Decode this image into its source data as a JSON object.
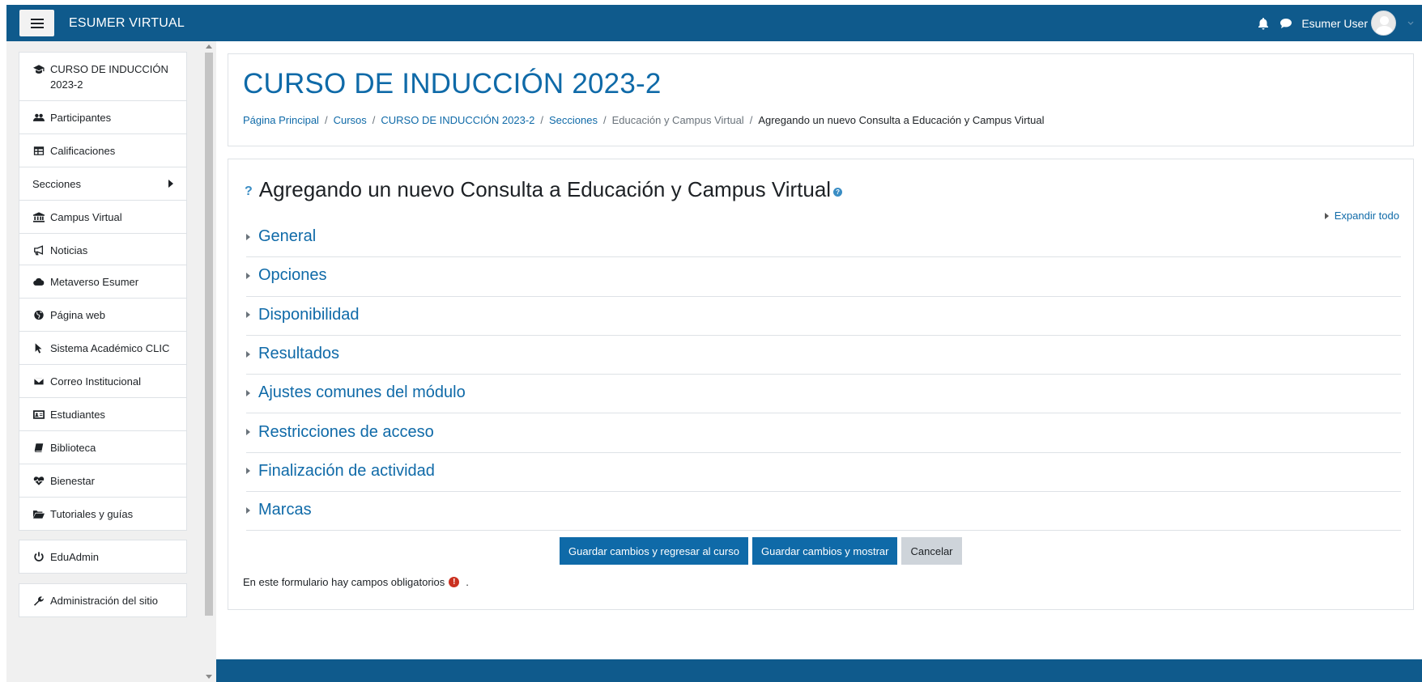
{
  "navbar": {
    "brand": "ESUMER VIRTUAL",
    "user_name": "Esumer User",
    "icons": [
      "menu-icon",
      "bell-icon",
      "chat-icon"
    ]
  },
  "drawer": {
    "group1": [
      {
        "label": "CURSO DE INDUCCIÓN 2023-2",
        "icon": "graduation-cap-icon"
      },
      {
        "label": "Participantes",
        "icon": "users-icon"
      },
      {
        "label": "Calificaciones",
        "icon": "table-icon"
      },
      {
        "label": "Secciones",
        "icon": ""
      },
      {
        "label": "Campus Virtual",
        "icon": "bank-icon"
      },
      {
        "label": "Noticias",
        "icon": "bullhorn-icon"
      }
    ],
    "group2": [
      {
        "label": "Metaverso Esumer",
        "icon": "cloud-icon"
      },
      {
        "label": "Página web",
        "icon": "globe-icon"
      },
      {
        "label": "Sistema Académico CLIC",
        "icon": "pointer-icon"
      },
      {
        "label": "Correo Institucional",
        "icon": "envelope-icon"
      },
      {
        "label": "Estudiantes",
        "icon": "id-card-icon"
      },
      {
        "label": "Biblioteca",
        "icon": "book-icon"
      },
      {
        "label": "Bienestar",
        "icon": "heartbeat-icon"
      },
      {
        "label": "Tutoriales y guías",
        "icon": "folder-open-icon"
      }
    ],
    "group3": [
      {
        "label": "EduAdmin",
        "icon": "power-icon"
      }
    ],
    "group4": [
      {
        "label": "Administración del sitio",
        "icon": "wrench-icon"
      }
    ]
  },
  "header": {
    "title": "CURSO DE INDUCCIÓN 2023-2",
    "breadcrumb": [
      {
        "label": "Página Principal",
        "type": "link"
      },
      {
        "label": "Cursos",
        "type": "link"
      },
      {
        "label": "CURSO DE INDUCCIÓN 2023-2",
        "type": "link"
      },
      {
        "label": "Secciones",
        "type": "link"
      },
      {
        "label": "Educación y Campus Virtual",
        "type": "muted"
      },
      {
        "label": "Agregando un nuevo Consulta a Educación y Campus Virtual",
        "type": "current"
      }
    ],
    "separator": "/"
  },
  "form": {
    "title": "Agregando un nuevo Consulta a Educación y Campus Virtual",
    "expand_all": "Expandir todo",
    "sections": [
      "General",
      "Opciones",
      "Disponibilidad",
      "Resultados",
      "Ajustes comunes del módulo",
      "Restricciones de acceso",
      "Finalización de actividad",
      "Marcas"
    ],
    "buttons": {
      "save_return": "Guardar cambios y regresar al curso",
      "save_display": "Guardar cambios y mostrar",
      "cancel": "Cancelar"
    },
    "required_note": "En este formulario hay campos obligatorios",
    "required_suffix": "."
  },
  "colors": {
    "navbar": "#0f5a8c",
    "link": "#0f6aa8",
    "primary_button": "#0f6aa8",
    "required": "#ca3120"
  }
}
